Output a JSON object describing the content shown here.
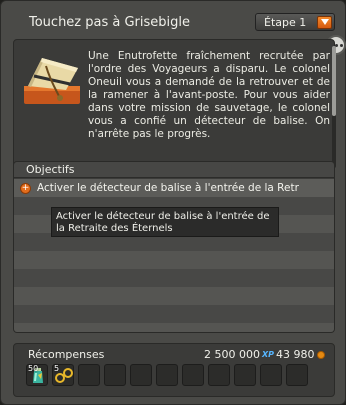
{
  "header": {
    "title": "Touchez pas à Grisebigle",
    "step_selected": "Étape 1"
  },
  "description": "Une Enutrofette fraîchement recrutée par l'ordre des Voyageurs a disparu. Le colonel Oneuil vous a demandé de la retrouver et de la ramener à l'avant-poste. Pour vous aider dans votre mission de sauvetage, le colonel vous a confié un détecteur de balise. On n'arrête pas le progrès.",
  "objectives": {
    "header": "Objectifs",
    "items": [
      {
        "text": "Activer le détecteur de balise à l'entrée de la Retr"
      }
    ],
    "tooltip": "Activer le détecteur de balise à l'entrée de la Retraite des Éternels"
  },
  "rewards": {
    "label": "Récompenses",
    "xp": "2 500 000",
    "xp_unit": "XP",
    "kamas": "43 980",
    "items": [
      {
        "quantity": "50",
        "icon": "potion-icon"
      },
      {
        "quantity": "5",
        "icon": "goggles-icon"
      }
    ],
    "empty_slots": 9
  },
  "colors": {
    "accent": "#e36d1c",
    "xp": "#57b6ff",
    "kamas": "#e58a12"
  }
}
